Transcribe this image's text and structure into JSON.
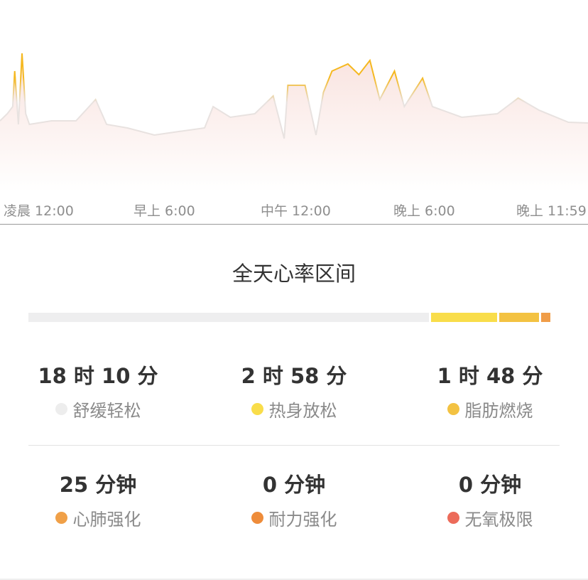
{
  "chart_data": {
    "type": "area",
    "title": "",
    "xlabel": "",
    "ylabel": "",
    "x_tick_labels": [
      "凌晨 12:00",
      "早上 6:00",
      "中午 12:00",
      "晚上 6:00",
      "晚上 11:59"
    ],
    "xlim_hours": [
      0,
      24
    ],
    "grid": false,
    "points": [
      [
        0,
        100
      ],
      [
        0.3,
        110
      ],
      [
        0.52,
        120
      ],
      [
        0.6,
        170
      ],
      [
        0.75,
        95
      ],
      [
        0.9,
        195
      ],
      [
        1.05,
        110
      ],
      [
        1.2,
        95
      ],
      [
        2.1,
        100
      ],
      [
        3.1,
        100
      ],
      [
        3.9,
        130
      ],
      [
        4.35,
        95
      ],
      [
        5.2,
        90
      ],
      [
        6.3,
        80
      ],
      [
        7.3,
        85
      ],
      [
        8.35,
        90
      ],
      [
        8.7,
        120
      ],
      [
        9.4,
        105
      ],
      [
        10.4,
        110
      ],
      [
        11.15,
        135
      ],
      [
        11.6,
        75
      ],
      [
        11.75,
        150
      ],
      [
        12.45,
        150
      ],
      [
        12.9,
        80
      ],
      [
        13.2,
        140
      ],
      [
        13.55,
        170
      ],
      [
        14.2,
        180
      ],
      [
        14.65,
        165
      ],
      [
        15.1,
        185
      ],
      [
        15.5,
        130
      ],
      [
        16.1,
        170
      ],
      [
        16.5,
        120
      ],
      [
        17.25,
        160
      ],
      [
        17.65,
        120
      ],
      [
        18.85,
        105
      ],
      [
        20.3,
        110
      ],
      [
        21.15,
        132
      ],
      [
        22.0,
        115
      ],
      [
        23.2,
        98
      ],
      [
        24,
        97
      ]
    ],
    "colors": {
      "high": "#f5b820",
      "low": "#e8e2e0",
      "fill": "#f9e3df"
    }
  },
  "section": {
    "title": "全天心率区间"
  },
  "zone_bar": [
    {
      "fraction": 0.76,
      "color": "#eeeeef"
    },
    {
      "fraction": 0.125,
      "color": "#f9dd4a"
    },
    {
      "fraction": 0.076,
      "color": "#f3c242"
    },
    {
      "fraction": 0.017,
      "color": "#f09d48"
    }
  ],
  "zones": [
    {
      "value": "18 时 10 分",
      "label": "舒缓轻松",
      "color": "#ededed"
    },
    {
      "value": "2 时 58 分",
      "label": "热身放松",
      "color": "#f9dd4a"
    },
    {
      "value": "1 时 48 分",
      "label": "脂肪燃烧",
      "color": "#f3c242"
    },
    {
      "value": "25 分钟",
      "label": "心肺强化",
      "color": "#f0a048"
    },
    {
      "value": "0 分钟",
      "label": "耐力强化",
      "color": "#ee8c3a"
    },
    {
      "value": "0 分钟",
      "label": "无氧极限",
      "color": "#ec6b5a"
    }
  ]
}
